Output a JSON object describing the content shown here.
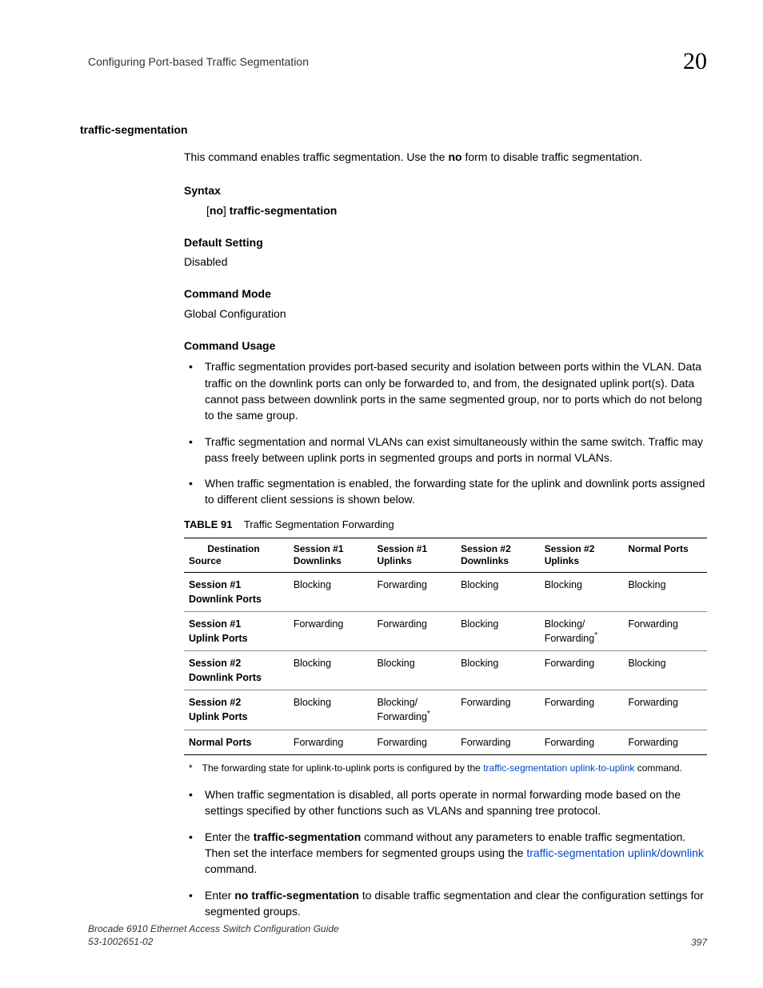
{
  "header": {
    "title": "Configuring Port-based Traffic Segmentation",
    "chapter": "20"
  },
  "section_title": "traffic-segmentation",
  "intro": "This command enables traffic segmentation. Use the ",
  "intro_bold": "no",
  "intro_after": " form to disable traffic segmentation.",
  "syntax": {
    "label": "Syntax",
    "open": "[",
    "no_bold": "no",
    "mid": "] ",
    "cmd": "traffic-segmentation"
  },
  "default_setting": {
    "label": "Default Setting",
    "value": "Disabled"
  },
  "command_mode": {
    "label": "Command Mode",
    "value": "Global Configuration"
  },
  "command_usage": {
    "label": "Command Usage",
    "items_top": [
      "Traffic segmentation provides port-based security and isolation between ports within the VLAN. Data traffic on the downlink ports can only be forwarded to, and from, the designated uplink port(s). Data cannot pass between downlink ports in the same segmented group, nor to ports which do not belong to the same group.",
      "Traffic segmentation and normal VLANs can exist simultaneously within the same switch. Traffic may pass freely between uplink ports in segmented groups and ports in normal VLANs.",
      "When traffic segmentation is enabled, the forwarding state for the uplink and downlink ports assigned to different client sessions is shown below."
    ],
    "items_bottom": {
      "b1": "When traffic segmentation is disabled, all ports operate in normal forwarding mode based on the settings specified by other functions such as VLANs and spanning tree protocol.",
      "b2_pre": "Enter the ",
      "b2_bold": "traffic-segmentation",
      "b2_mid": " command without any parameters to enable traffic segmentation. Then set the interface members for segmented groups using the ",
      "b2_link": "traffic-segmentation uplink/downlink",
      "b2_post": " command.",
      "b3_pre": "Enter ",
      "b3_bold": "no traffic-segmentation",
      "b3_post": " to disable traffic segmentation and clear the configuration settings for segmented groups."
    }
  },
  "table": {
    "caption_label": "TABLE 91",
    "caption_title": "Traffic Segmentation Forwarding",
    "headers": {
      "c0a": "Destination",
      "c0b": "Source",
      "c1a": "Session #1",
      "c1b": "Downlinks",
      "c2a": "Session #1",
      "c2b": "Uplinks",
      "c3a": "Session #2",
      "c3b": "Downlinks",
      "c4a": "Session #2",
      "c4b": "Uplinks",
      "c5": "Normal Ports"
    },
    "rows": [
      {
        "h": "Session #1 Downlink Ports",
        "c": [
          "Blocking",
          "Forwarding",
          "Blocking",
          "Blocking",
          "Blocking"
        ],
        "star": []
      },
      {
        "h": "Session #1 Uplink Ports",
        "c": [
          "Forwarding",
          "Forwarding",
          "Blocking",
          "Blocking/ Forwarding",
          "Forwarding"
        ],
        "star": [
          3
        ]
      },
      {
        "h": "Session #2 Downlink Ports",
        "c": [
          "Blocking",
          "Blocking",
          "Blocking",
          "Forwarding",
          "Blocking"
        ],
        "star": []
      },
      {
        "h": "Session #2 Uplink Ports",
        "c": [
          "Blocking",
          "Blocking/ Forwarding",
          "Forwarding",
          "Forwarding",
          "Forwarding"
        ],
        "star": [
          1
        ]
      },
      {
        "h": "Normal Ports",
        "c": [
          "Forwarding",
          "Forwarding",
          "Forwarding",
          "Forwarding",
          "Forwarding"
        ],
        "star": []
      }
    ],
    "footnote": {
      "star": "*",
      "text_pre": "The forwarding state for uplink-to-uplink ports is configured by the ",
      "link": "traffic-segmentation uplink-to-uplink",
      "text_post": " command."
    }
  },
  "footer": {
    "line1": "Brocade 6910 Ethernet Access Switch Configuration Guide",
    "line2": "53-1002651-02",
    "page": "397"
  }
}
